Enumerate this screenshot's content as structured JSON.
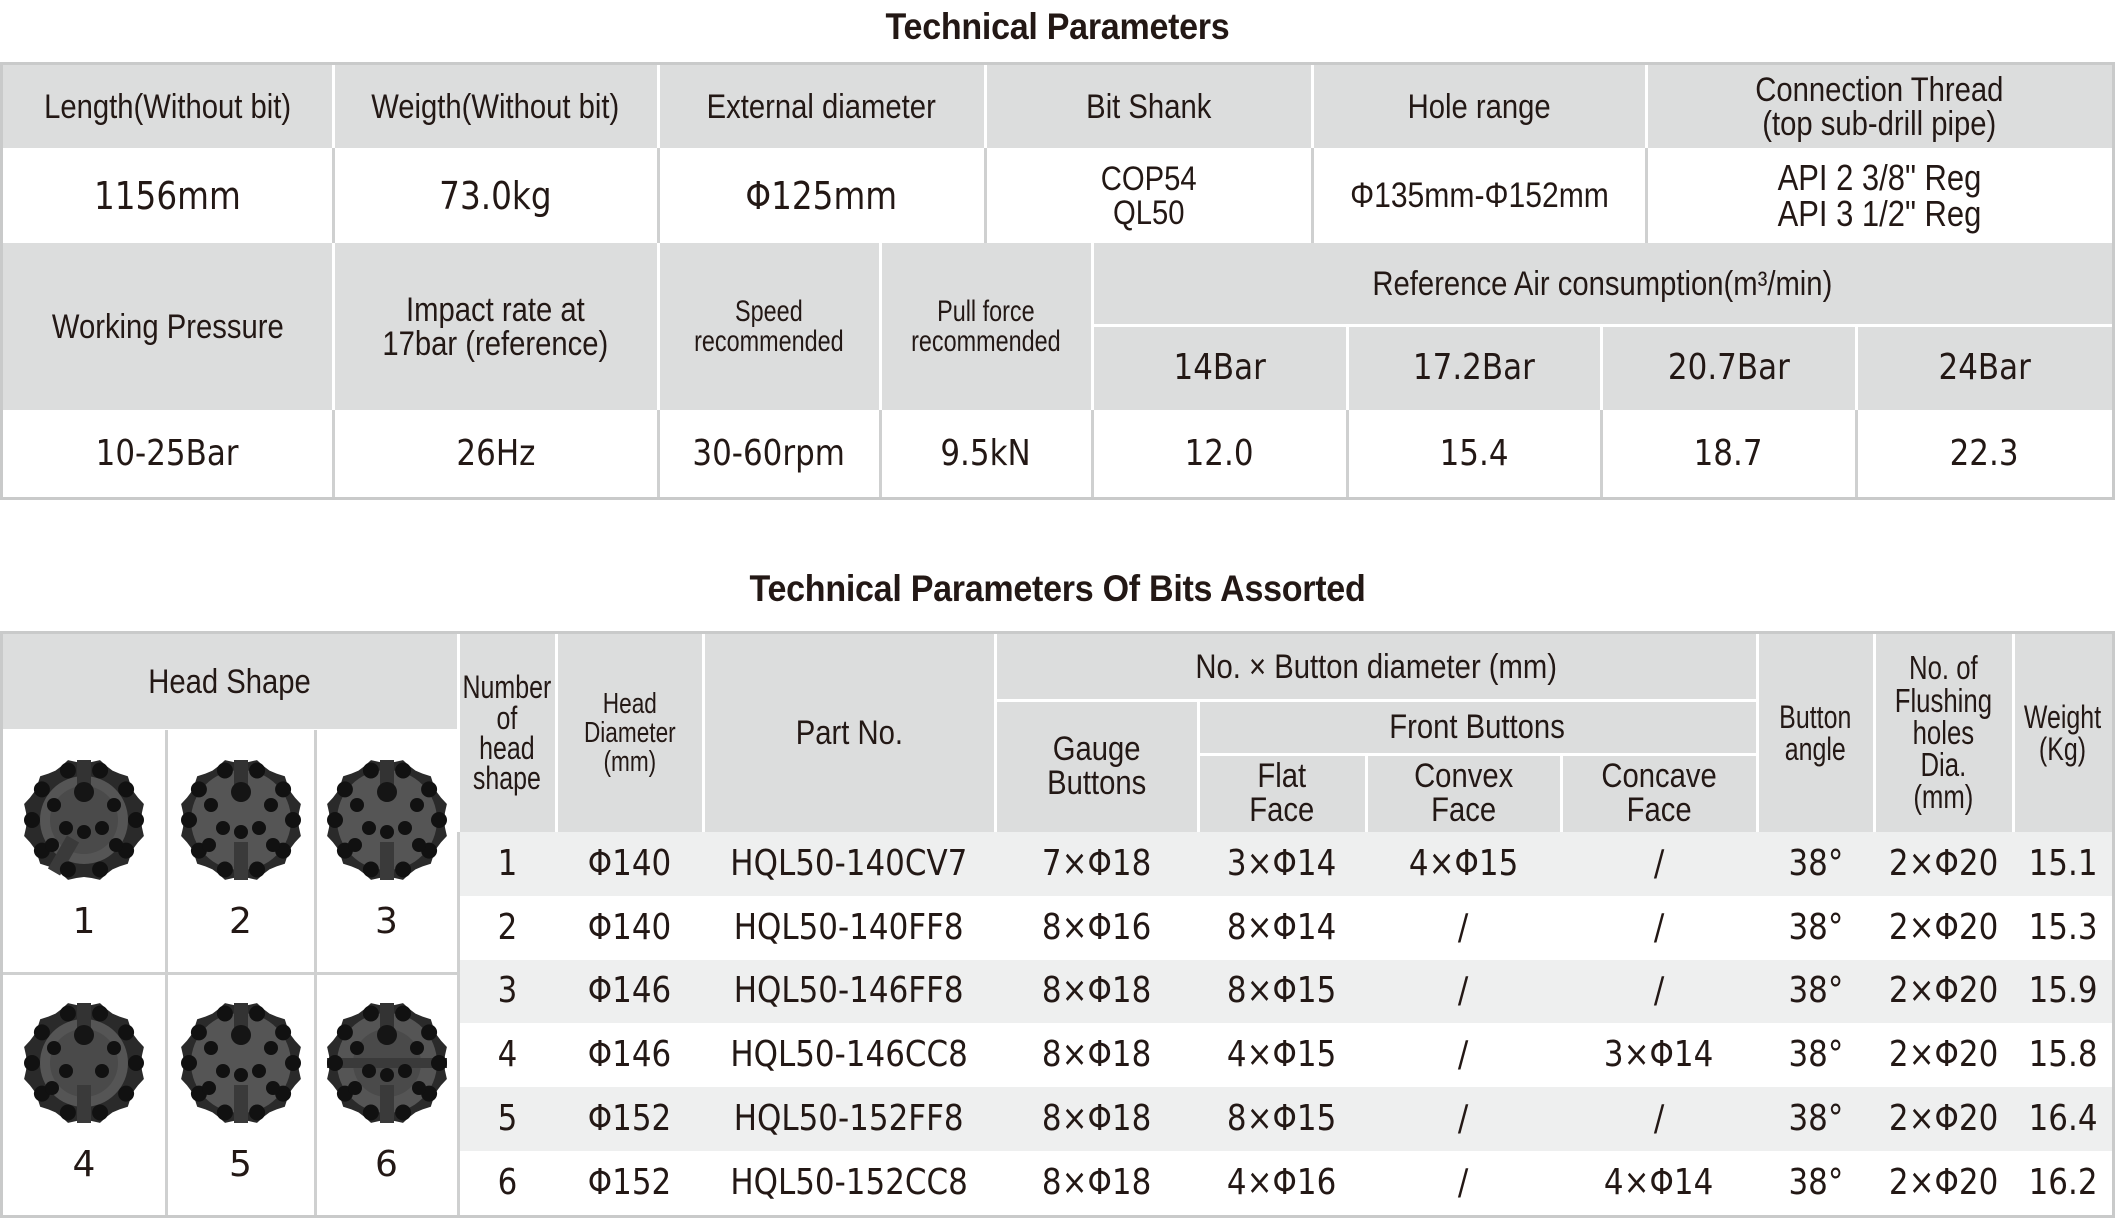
{
  "tech_params": {
    "title": "Technical Parameters",
    "top_headers": [
      "Length(Without bit)",
      "Weigth(Without bit)",
      "External diameter",
      "Bit Shank",
      "Hole range",
      [
        "Connection Thread",
        "(top sub-drill pipe)"
      ]
    ],
    "top_values": [
      "1156mm",
      "73.0kg",
      "Φ125mm",
      [
        "COP54",
        "QL50"
      ],
      "Φ135mm-Φ152mm",
      [
        "API 2  3/8\" Reg",
        "API 3  1/2\" Reg"
      ]
    ],
    "bottom_headers": {
      "working_pressure": "Working Pressure",
      "impact_rate": [
        "Impact rate at",
        "17bar (reference)"
      ],
      "speed": [
        "Speed",
        "recommended"
      ],
      "pull_force": [
        "Pull force",
        "recommended"
      ],
      "air_consumption": "Reference Air consumption(m³/min)",
      "pressures": [
        "14Bar",
        "17.2Bar",
        "20.7Bar",
        "24Bar"
      ]
    },
    "bottom_values": {
      "working_pressure": "10-25Bar",
      "impact_rate": "26Hz",
      "speed": "30-60rpm",
      "pull_force": "9.5kN",
      "air": [
        "12.0",
        "15.4",
        "18.7",
        "22.3"
      ]
    }
  },
  "bits": {
    "title": "Technical Parameters Of Bits Assorted",
    "headers": {
      "head_shape": "Head Shape",
      "number_of_head_shape": [
        "Number",
        "of",
        "head",
        "shape"
      ],
      "head_diameter": [
        "Head",
        "Diameter",
        "(mm)"
      ],
      "part_no": "Part  No.",
      "button_group": "No. × Button  diameter (mm)",
      "gauge_buttons": [
        "Gauge",
        "Buttons"
      ],
      "front_buttons": "Front Buttons",
      "flat_face": [
        "Flat",
        "Face"
      ],
      "convex_face": [
        "Convex",
        "Face"
      ],
      "concave_face": [
        "Concave",
        "Face"
      ],
      "button_angle": [
        "Button",
        "angle"
      ],
      "flushing": [
        "No. of",
        "Flushing",
        "holes",
        "Dia.",
        "(mm)"
      ],
      "weight": [
        "Weight",
        "(Kg)"
      ]
    },
    "shape_labels": [
      "1",
      "2",
      "3",
      "4",
      "5",
      "6"
    ],
    "shape_icons": [
      "drill-bit-concave-icon",
      "drill-bit-flat-icon",
      "drill-bit-flat-icon",
      "drill-bit-concave-icon",
      "drill-bit-flat-icon",
      "drill-bit-concave-cross-icon"
    ],
    "rows": [
      {
        "no": "1",
        "dia": "Φ140",
        "part": "HQL50-140CV7",
        "gauge": "7×Φ18",
        "flat": "3×Φ14",
        "convex": "4×Φ15",
        "concave": "/",
        "angle": "38°",
        "flush": "2×Φ20",
        "weight": "15.1"
      },
      {
        "no": "2",
        "dia": "Φ140",
        "part": "HQL50-140FF8",
        "gauge": "8×Φ16",
        "flat": "8×Φ14",
        "convex": "/",
        "concave": "/",
        "angle": "38°",
        "flush": "2×Φ20",
        "weight": "15.3"
      },
      {
        "no": "3",
        "dia": "Φ146",
        "part": "HQL50-146FF8",
        "gauge": "8×Φ18",
        "flat": "8×Φ15",
        "convex": "/",
        "concave": "/",
        "angle": "38°",
        "flush": "2×Φ20",
        "weight": "15.9"
      },
      {
        "no": "4",
        "dia": "Φ146",
        "part": "HQL50-146CC8",
        "gauge": "8×Φ18",
        "flat": "4×Φ15",
        "convex": "/",
        "concave": "3×Φ14",
        "angle": "38°",
        "flush": "2×Φ20",
        "weight": "15.8"
      },
      {
        "no": "5",
        "dia": "Φ152",
        "part": "HQL50-152FF8",
        "gauge": "8×Φ18",
        "flat": "8×Φ15",
        "convex": "/",
        "concave": "/",
        "angle": "38°",
        "flush": "2×Φ20",
        "weight": "16.4"
      },
      {
        "no": "6",
        "dia": "Φ152",
        "part": "HQL50-152CC8",
        "gauge": "8×Φ18",
        "flat": "4×Φ16",
        "convex": "/",
        "concave": "4×Φ14",
        "angle": "38°",
        "flush": "2×Φ20",
        "weight": "16.2"
      }
    ]
  },
  "colors": {
    "header_bg": "#dcdddd",
    "row_alt_bg": "#eeefef",
    "border": "#c9caca",
    "text": "#231815"
  }
}
